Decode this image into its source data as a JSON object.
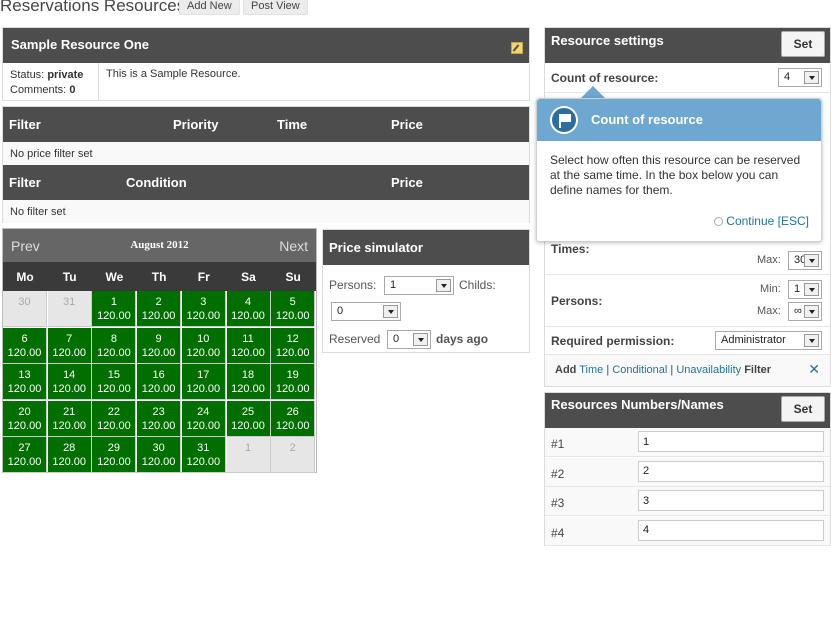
{
  "header": {
    "title": "Reservations Resources",
    "add_new": "Add New",
    "post_view": "Post View"
  },
  "resource": {
    "name": "Sample Resource One",
    "status_label": "Status:",
    "status_value": "private",
    "comments_label": "Comments:",
    "comments_value": "0",
    "description": "This is a Sample Resource."
  },
  "price_filters": {
    "columns": [
      "Filter",
      "Priority",
      "Time",
      "Price"
    ],
    "empty": "No price filter set"
  },
  "filters": {
    "columns": [
      "Filter",
      "Condition",
      "Price"
    ],
    "empty": "No filter set"
  },
  "calendar": {
    "prev": "Prev",
    "next": "Next",
    "month": "August 2012",
    "weekdays": [
      "Mo",
      "Tu",
      "We",
      "Th",
      "Fr",
      "Sa",
      "Su"
    ],
    "weeks": [
      [
        {
          "d": "30",
          "p": "",
          "other": true
        },
        {
          "d": "31",
          "p": "",
          "other": true
        },
        {
          "d": "1",
          "p": "120.00"
        },
        {
          "d": "2",
          "p": "120.00"
        },
        {
          "d": "3",
          "p": "120.00"
        },
        {
          "d": "4",
          "p": "120.00"
        },
        {
          "d": "5",
          "p": "120.00"
        }
      ],
      [
        {
          "d": "6",
          "p": "120.00"
        },
        {
          "d": "7",
          "p": "120.00"
        },
        {
          "d": "8",
          "p": "120.00"
        },
        {
          "d": "9",
          "p": "120.00"
        },
        {
          "d": "10",
          "p": "120.00"
        },
        {
          "d": "11",
          "p": "120.00"
        },
        {
          "d": "12",
          "p": "120.00"
        }
      ],
      [
        {
          "d": "13",
          "p": "120.00"
        },
        {
          "d": "14",
          "p": "120.00"
        },
        {
          "d": "15",
          "p": "120.00"
        },
        {
          "d": "16",
          "p": "120.00"
        },
        {
          "d": "17",
          "p": "120.00"
        },
        {
          "d": "18",
          "p": "120.00"
        },
        {
          "d": "19",
          "p": "120.00"
        }
      ],
      [
        {
          "d": "20",
          "p": "120.00"
        },
        {
          "d": "21",
          "p": "120.00"
        },
        {
          "d": "22",
          "p": "120.00"
        },
        {
          "d": "23",
          "p": "120.00"
        },
        {
          "d": "24",
          "p": "120.00"
        },
        {
          "d": "25",
          "p": "120.00"
        },
        {
          "d": "26",
          "p": "120.00"
        }
      ],
      [
        {
          "d": "27",
          "p": "120.00"
        },
        {
          "d": "28",
          "p": "120.00"
        },
        {
          "d": "29",
          "p": "120.00"
        },
        {
          "d": "30",
          "p": "120.00"
        },
        {
          "d": "31",
          "p": "120.00"
        },
        {
          "d": "1",
          "p": "",
          "other": true
        },
        {
          "d": "2",
          "p": "",
          "other": true
        }
      ]
    ]
  },
  "simulator": {
    "title": "Price simulator",
    "persons_label": "Persons:",
    "persons_value": "1",
    "childs_label": "Childs:",
    "childs_value": "0",
    "reserved_label": "Reserved",
    "reserved_value": "0",
    "days_ago": "days ago"
  },
  "settings": {
    "title": "Resource settings",
    "set": "Set",
    "count_label": "Count of resource:",
    "count_value": "4",
    "times_label": "Times:",
    "times_max_label": "Max:",
    "times_max_value": "30",
    "persons_label": "Persons:",
    "persons_min_label": "Min:",
    "persons_min_value": "1",
    "persons_max_label": "Max:",
    "persons_max_value": "∞",
    "permission_label": "Required permission:",
    "permission_value": "Administrator",
    "add_word": "Add",
    "time_link": "Time",
    "conditional_link": "Conditional",
    "unavailability_link": "Unavailability",
    "filter_word": "Filter"
  },
  "tooltip": {
    "title": "Count of resource",
    "body": "Select how often this resource can be reserved at the same time. In the box below you can define names for them.",
    "continue": "Continue [ESC]"
  },
  "names": {
    "title": "Resources Numbers/Names",
    "set": "Set",
    "rows": [
      {
        "label": "#1",
        "value": "1"
      },
      {
        "label": "#2",
        "value": "2"
      },
      {
        "label": "#3",
        "value": "3"
      },
      {
        "label": "#4",
        "value": "4"
      }
    ]
  },
  "colors": {
    "available": "#006f00",
    "header_dark": "#4d4d4d",
    "tooltip_blue": "#6ea7cf",
    "link": "#21759b"
  }
}
